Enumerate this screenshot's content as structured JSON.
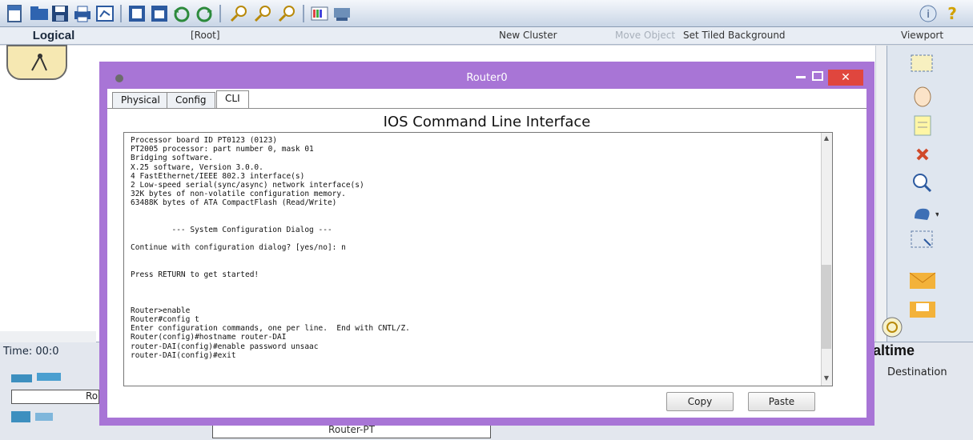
{
  "toolbar": {
    "icons": [
      "new-icon",
      "open-icon",
      "save-icon",
      "print-icon",
      "activity-wizard-icon",
      "copy-icon",
      "paste-icon",
      "undo-icon",
      "redo-icon",
      "zoom-in-icon",
      "zoom-reset-icon",
      "zoom-out-icon",
      "palette-icon",
      "custom-device-icon"
    ],
    "info": "i",
    "help": "?"
  },
  "bar2": {
    "logical": "Logical",
    "root": "[Root]",
    "new_cluster": "New Cluster",
    "move_object": "Move Object",
    "set_tiled_background": "Set Tiled Background",
    "viewport": "Viewport"
  },
  "window": {
    "title": "Router0",
    "close": "✕",
    "tabs": [
      "Physical",
      "Config",
      "CLI"
    ],
    "active_tab": "CLI",
    "heading": "IOS Command Line Interface",
    "console_lines": [
      "Processor board ID PT0123 (0123)",
      "PT2005 processor: part number 0, mask 01",
      "Bridging software.",
      "X.25 software, Version 3.0.0.",
      "4 FastEthernet/IEEE 802.3 interface(s)",
      "2 Low-speed serial(sync/async) network interface(s)",
      "32K bytes of non-volatile configuration memory.",
      "63488K bytes of ATA CompactFlash (Read/Write)",
      "",
      "",
      "         --- System Configuration Dialog ---",
      "",
      "Continue with configuration dialog? [yes/no]: n",
      "",
      "",
      "Press RETURN to get started!",
      "",
      "",
      "",
      "Router>enable",
      "Router#config t",
      "Enter configuration commands, one per line.  End with CNTL/Z.",
      "Router(config)#hostname router-DAI",
      "router-DAI(config)#enable password unsaac",
      "router-DAI(config)#exit"
    ],
    "copy_label": "Copy",
    "paste_label": "Paste"
  },
  "bottom": {
    "time": "Time: 00:0",
    "realtime": "altime",
    "destination": "Destination",
    "device_label": "Ro",
    "device_model": "Router-PT"
  },
  "colors": {
    "window_border": "#a875d6",
    "close_button": "#e0463e"
  }
}
